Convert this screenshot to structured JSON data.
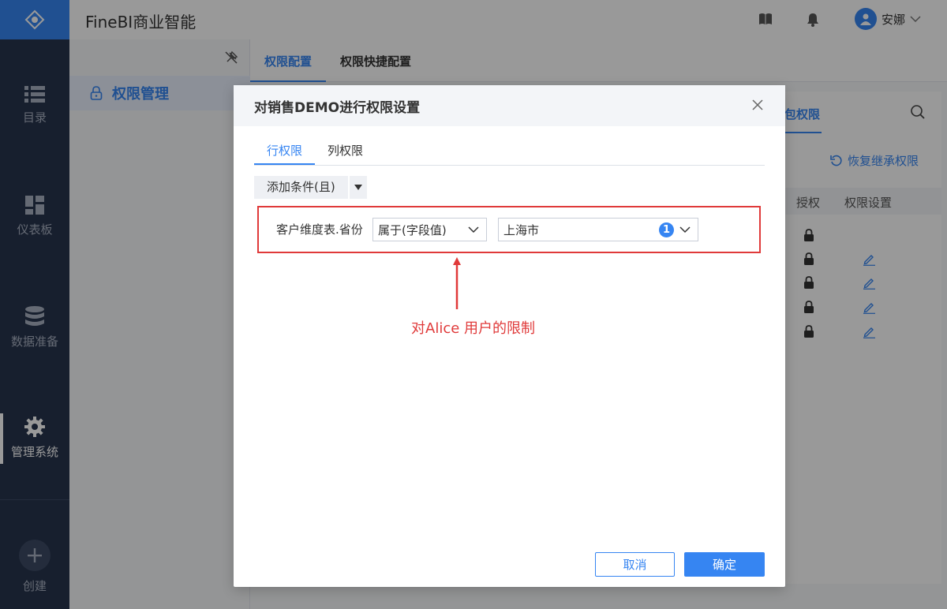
{
  "app": {
    "title": "FineBI商业智能",
    "user": "安娜"
  },
  "nav": {
    "items": [
      {
        "label": "目录",
        "icon": "list-icon"
      },
      {
        "label": "仪表板",
        "icon": "dashboard-icon"
      },
      {
        "label": "数据准备",
        "icon": "database-icon"
      },
      {
        "label": "管理系统",
        "icon": "gear-icon",
        "active": true
      },
      {
        "label": "创建",
        "icon": "plus-circle-icon"
      }
    ]
  },
  "sidebar": {
    "menu_item": "权限管理"
  },
  "content": {
    "tabs": [
      "权限配置",
      "权限快捷配置"
    ],
    "panel_tab": "包权限",
    "restore_label": "恢复继承权限",
    "columns": [
      "授权",
      "权限设置"
    ]
  },
  "dialog": {
    "title": "对销售DEMO进行权限设置",
    "tabs": [
      "行权限",
      "列权限"
    ],
    "add_condition": "添加条件(且)",
    "condition": {
      "field": "客户维度表.省份",
      "operator": "属于(字段值)",
      "value": "上海市",
      "count": "1"
    },
    "annotation": "对Alice 用户的限制",
    "cancel": "取消",
    "confirm": "确定"
  },
  "colors": {
    "accent": "#3685f2",
    "nav_bg": "#27344d",
    "annotation": "#e03a3a"
  }
}
